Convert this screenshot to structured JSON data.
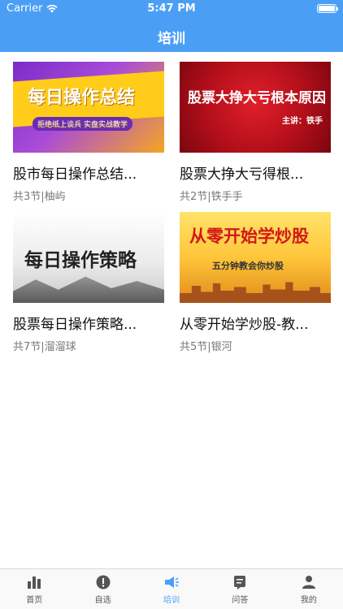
{
  "status_bar": {
    "carrier": "Carrier",
    "time": "5:47 PM"
  },
  "nav": {
    "title": "培训"
  },
  "courses": [
    {
      "title": "股市每日操作总结...",
      "meta": "共3节|柚屿",
      "thumb_title": "每日操作总结",
      "thumb_sub": "拒绝纸上谈兵  实盘实战教学"
    },
    {
      "title": "股票大挣大亏得根...",
      "meta": "共2节|铁手手",
      "thumb_title": "股票大挣大亏根本原因",
      "thumb_sub": "主讲：铁手"
    },
    {
      "title": "股票每日操作策略...",
      "meta": "共7节|溜溜球",
      "thumb_title": "每日操作策略"
    },
    {
      "title": "从零开始学炒股-教...",
      "meta": "共5节|银河",
      "thumb_title": "从零开始学炒股",
      "thumb_sub": "五分钟教会你炒股"
    }
  ],
  "tabbar": {
    "items": [
      {
        "label": "首页",
        "icon": "bar-chart-icon"
      },
      {
        "label": "自选",
        "icon": "info-icon"
      },
      {
        "label": "培训",
        "icon": "megaphone-icon",
        "active": true
      },
      {
        "label": "问答",
        "icon": "chat-icon"
      },
      {
        "label": "我的",
        "icon": "person-icon"
      }
    ]
  },
  "colors": {
    "primary": "#4a9ff5",
    "tab_inactive": "#555555"
  }
}
